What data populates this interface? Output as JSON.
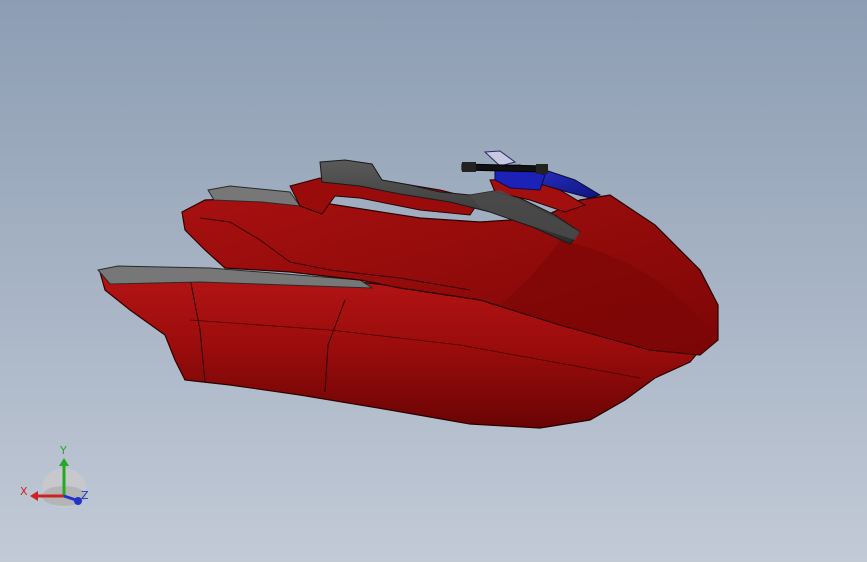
{
  "viewport": {
    "background_top": "#8d9db3",
    "background_bottom": "#c2cad6"
  },
  "model": {
    "hull_color": "#a30f0f",
    "hull_shadow_color": "#6e0505",
    "seat_color": "#3a3a3a",
    "console_color": "#1a1fa8",
    "handlebar_color": "#111111"
  },
  "triad": {
    "x_label": "X",
    "y_label": "Y",
    "z_label": "Z",
    "x_color": "#cc2222",
    "y_color": "#22aa22",
    "z_color": "#2233cc"
  }
}
